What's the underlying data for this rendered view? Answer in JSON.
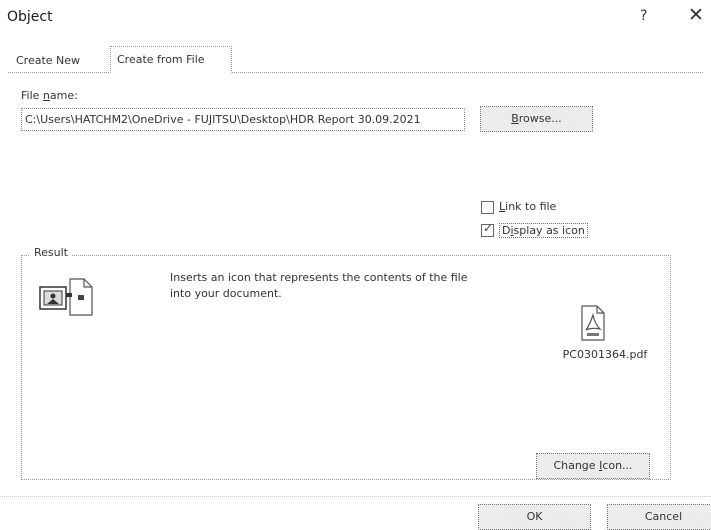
{
  "window": {
    "title": "Object",
    "help_label": "?",
    "close_label": "✕"
  },
  "tabs": [
    {
      "label": "Create New",
      "active": false
    },
    {
      "label": "Create from File",
      "active": true
    }
  ],
  "file_name": {
    "label_pre": "File ",
    "label_accel": "n",
    "label_post": "ame:",
    "value": "C:\\Users\\HATCHM2\\OneDrive - FUJITSU\\Desktop\\HDR Report 30.09.2021"
  },
  "browse": {
    "pre": "",
    "accel": "B",
    "post": "rowse..."
  },
  "link_to_file": {
    "pre": "",
    "accel": "L",
    "post": "ink to file",
    "checked": false
  },
  "display_as_icon": {
    "pre": "D",
    "accel": "i",
    "post": "splay as icon",
    "checked": true
  },
  "result": {
    "legend": "Result",
    "description": "Inserts an icon that represents the contents of the file into your document."
  },
  "icon_preview": {
    "file_name": "PC0301364.pdf"
  },
  "change_icon": {
    "pre": "Change ",
    "accel": "I",
    "post": "con..."
  },
  "ok_label": "OK",
  "cancel_label": "Cancel"
}
